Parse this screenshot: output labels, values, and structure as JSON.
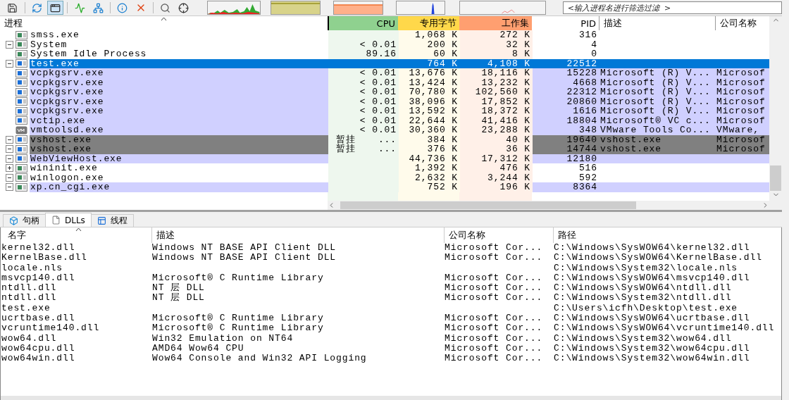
{
  "toolbar": {
    "filter": {
      "placeholder": "<输入进程名进行筛选过滤  >"
    }
  },
  "processes": {
    "columns": [
      "进程",
      "CPU",
      "专用字节",
      "工作集",
      "PID",
      "描述",
      "公司名称"
    ],
    "rows": [
      {
        "name": "smss.exe",
        "kind": "sys",
        "selected": false,
        "color": "#ffffff",
        "private": "1,068 K",
        "working": "272 K",
        "pid": "316"
      },
      {
        "name": "System",
        "kind": "sys",
        "selected": false,
        "color": "#ffffff",
        "expanded": true,
        "cpu": "< 0.01",
        "private": "200 K",
        "working": "32 K",
        "pid": "4"
      },
      {
        "name": "System Idle Process",
        "kind": "sys",
        "selected": false,
        "color": "#ffffff",
        "cpu": "89.16",
        "private": "60 K",
        "working": "8 K",
        "pid": "0"
      },
      {
        "name": "test.exe",
        "kind": "app",
        "selected": true,
        "expanded": true,
        "private": "764 K",
        "working": "4,108 K",
        "pid": "22512"
      },
      {
        "name": "vcpkgsrv.exe",
        "kind": "app",
        "selected": false,
        "color": "#d0d0ff",
        "cpu": "< 0.01",
        "private": "13,676 K",
        "working": "18,116 K",
        "pid": "15228",
        "description": "Microsoft (R) V...",
        "company": "Microsof"
      },
      {
        "name": "vcpkgsrv.exe",
        "kind": "app",
        "selected": false,
        "color": "#d0d0ff",
        "cpu": "< 0.01",
        "private": "13,424 K",
        "working": "13,232 K",
        "pid": "4668",
        "description": "Microsoft (R) V...",
        "company": "Microsof"
      },
      {
        "name": "vcpkgsrv.exe",
        "kind": "app",
        "selected": false,
        "color": "#d0d0ff",
        "cpu": "< 0.01",
        "private": "70,780 K",
        "working": "102,560 K",
        "pid": "22312",
        "description": "Microsoft (R) V...",
        "company": "Microsof"
      },
      {
        "name": "vcpkgsrv.exe",
        "kind": "app",
        "selected": false,
        "color": "#d0d0ff",
        "cpu": "< 0.01",
        "private": "38,096 K",
        "working": "17,852 K",
        "pid": "20860",
        "description": "Microsoft (R) V...",
        "company": "Microsof"
      },
      {
        "name": "vcpkgsrv.exe",
        "kind": "app",
        "selected": false,
        "color": "#d0d0ff",
        "cpu": "< 0.01",
        "private": "13,592 K",
        "working": "18,372 K",
        "pid": "1616",
        "description": "Microsoft (R) V...",
        "company": "Microsof"
      },
      {
        "name": "vctip.exe",
        "kind": "app",
        "selected": false,
        "color": "#d0d0ff",
        "cpu": "< 0.01",
        "private": "22,644 K",
        "working": "41,416 K",
        "pid": "18804",
        "description": "Microsoft® VC c...",
        "company": "Microsof"
      },
      {
        "name": "vmtoolsd.exe",
        "kind": "vm",
        "selected": false,
        "color": "#d0d0ff",
        "cpu": "< 0.01",
        "private": "30,360 K",
        "working": "23,288 K",
        "pid": "348",
        "description": "VMware Tools Co...",
        "company": "VMware,"
      },
      {
        "name": "vshost.exe",
        "kind": "app",
        "selected": false,
        "color": "#808080",
        "expanded": true,
        "status": "暂挂",
        "cpu": "...",
        "private": "384 K",
        "working": "40 K",
        "pid": "19640",
        "description": "vshost.exe",
        "company": "Microsof"
      },
      {
        "name": "vshost.exe",
        "kind": "app",
        "selected": false,
        "color": "#808080",
        "expanded": true,
        "status": "暂挂",
        "cpu": "...",
        "private": "376 K",
        "working": "36 K",
        "pid": "14744",
        "description": "vshost.exe",
        "company": "Microsof"
      },
      {
        "name": "WebViewHost.exe",
        "kind": "app",
        "selected": false,
        "color": "#d0d0ff",
        "expanded": true,
        "private": "44,736 K",
        "working": "17,312 K",
        "pid": "12180"
      },
      {
        "name": "wininit.exe",
        "kind": "sys",
        "selected": false,
        "color": "#ffffff",
        "expanded": false,
        "private": "1,392 K",
        "working": "476 K",
        "pid": "516"
      },
      {
        "name": "winlogon.exe",
        "kind": "sys",
        "selected": false,
        "color": "#ffffff",
        "expanded": true,
        "private": "2,632 K",
        "working": "3,244 K",
        "pid": "592"
      },
      {
        "name": "xp.cn_cgi.exe",
        "kind": "sys",
        "selected": false,
        "color": "#d0d0ff",
        "expanded": true,
        "private": "752 K",
        "working": "196 K",
        "pid": "8364"
      }
    ]
  },
  "lower_tabs": [
    {
      "label": "句柄",
      "selected": false,
      "kind": "handles"
    },
    {
      "label": "DLLs",
      "selected": true,
      "kind": "dlls"
    },
    {
      "label": "线程",
      "selected": false,
      "kind": "threads"
    }
  ],
  "dlls": {
    "columns": [
      "名字",
      "描述",
      "公司名称",
      "路径"
    ],
    "rows": [
      {
        "name": "kernel32.dll",
        "description": "Windows NT BASE API Client DLL",
        "company": "Microsoft Cor...",
        "path": "C:\\Windows\\SysWOW64\\kernel32.dll"
      },
      {
        "name": "KernelBase.dll",
        "description": "Windows NT BASE API Client DLL",
        "company": "Microsoft Cor...",
        "path": "C:\\Windows\\SysWOW64\\KernelBase.dll"
      },
      {
        "name": "locale.nls",
        "path": "C:\\Windows\\System32\\locale.nls"
      },
      {
        "name": "msvcp140.dll",
        "description": "Microsoft® C Runtime Library",
        "company": "Microsoft Cor...",
        "path": "C:\\Windows\\SysWOW64\\msvcp140.dll"
      },
      {
        "name": "ntdll.dll",
        "description": "NT 层 DLL",
        "company": "Microsoft Cor...",
        "path": "C:\\Windows\\SysWOW64\\ntdll.dll"
      },
      {
        "name": "ntdll.dll",
        "description": "NT 层 DLL",
        "company": "Microsoft Cor...",
        "path": "C:\\Windows\\System32\\ntdll.dll"
      },
      {
        "name": "test.exe",
        "path": "C:\\Users\\icfh\\Desktop\\test.exe"
      },
      {
        "name": "ucrtbase.dll",
        "description": "Microsoft® C Runtime Library",
        "company": "Microsoft Cor...",
        "path": "C:\\Windows\\SysWOW64\\ucrtbase.dll"
      },
      {
        "name": "vcruntime140.dll",
        "description": "Microsoft® C Runtime Library",
        "company": "Microsoft Cor...",
        "path": "C:\\Windows\\SysWOW64\\vcruntime140.dll"
      },
      {
        "name": "wow64.dll",
        "description": "Win32 Emulation on NT64",
        "company": "Microsoft Cor...",
        "path": "C:\\Windows\\System32\\wow64.dll"
      },
      {
        "name": "wow64cpu.dll",
        "description": "AMD64 Wow64 CPU",
        "company": "Microsoft Cor...",
        "path": "C:\\Windows\\System32\\wow64cpu.dll"
      },
      {
        "name": "wow64win.dll",
        "description": "Wow64 Console and Win32 API Logging",
        "company": "Microsoft Cor...",
        "path": "C:\\Windows\\System32\\wow64win.dll"
      }
    ]
  }
}
